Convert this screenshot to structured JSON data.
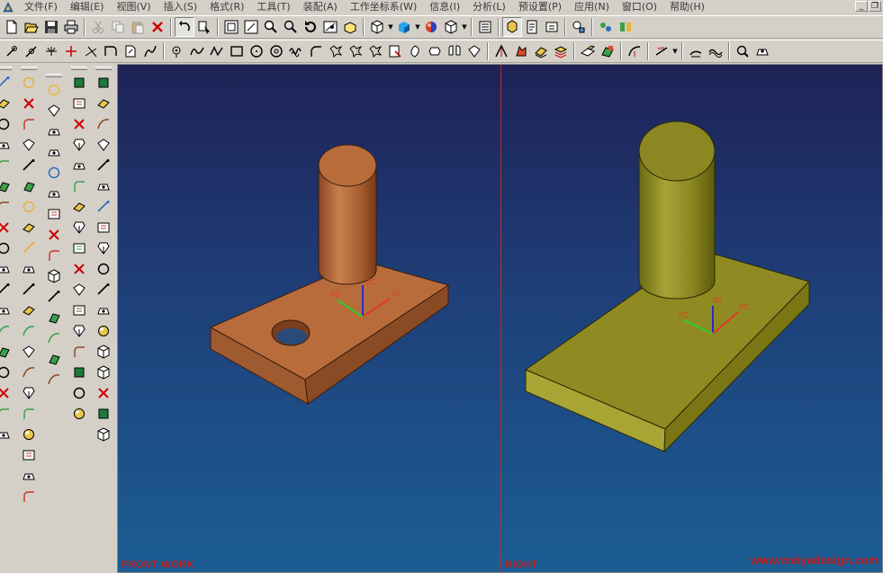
{
  "menu": {
    "items": [
      "文件(F)",
      "编辑(E)",
      "视图(V)",
      "插入(S)",
      "格式(R)",
      "工具(T)",
      "装配(A)",
      "工作坐标系(W)",
      "信息(I)",
      "分析(L)",
      "预设置(P)",
      "应用(N)",
      "窗口(O)",
      "帮助(H)"
    ]
  },
  "toolbar1": {
    "icons": [
      "new-file-icon",
      "open-file-icon",
      "save-icon",
      "print-icon",
      "cut-icon",
      "copy-icon",
      "paste-icon",
      "delete-icon",
      "undo-icon",
      "select-icon",
      "fit-icon",
      "zoom-window-icon",
      "zoom-icon",
      "pan-icon",
      "rotate-icon",
      "shade-mode-icon",
      "perspective-icon",
      "view-orient-icon",
      "render-cube-icon",
      "color-ball-icon",
      "layer-cube-icon",
      "layer-settings-icon",
      "modeling-app-icon",
      "drafting-app-icon",
      "info-icon",
      "measure-icon",
      "analysis-icon"
    ]
  },
  "toolbar2": {
    "icons": [
      "snap-end-icon",
      "snap-mid-icon",
      "snap-line-icon",
      "snap-point-icon",
      "snap-intersect-icon",
      "snap-arc-icon",
      "snap-face-icon",
      "snap-curve-icon",
      "point-icon",
      "spline-icon",
      "polyline-icon",
      "rectangle-icon",
      "circle-icon",
      "ellipse-icon",
      "helix-icon",
      "fillet-icon",
      "chamfer-icon",
      "offset-icon",
      "trim-icon",
      "extend-icon",
      "divide-icon",
      "join-icon",
      "bridge-icon",
      "project-icon",
      "mirror-icon",
      "section-icon",
      "hand-icon",
      "layer-stack-icon",
      "stack2-icon",
      "paint-icon",
      "color-icon",
      "arc-icon",
      "dimension-icon",
      "dropdown-icon",
      "sketch-icon",
      "curve-icon",
      "search-icon",
      "hole-icon"
    ]
  },
  "left_toolbars": {
    "strip1": [
      "line-tool-icon",
      "arc-tool-icon",
      "circle-tool-icon",
      "fillet-tool-icon",
      "chamfer-tool-icon",
      "rect-tool-icon",
      "polygon-tool-icon",
      "ellipse-tool-icon",
      "spline-tool-icon",
      "offset-tool-icon",
      "trim-tool-icon",
      "extend-tool-icon",
      "split-tool-icon",
      "join-tool-icon",
      "mirror-tool-icon",
      "project-tool-icon",
      "section-tool-icon",
      "bridge-tool-icon"
    ],
    "strip2": [
      "sketch-tool-icon",
      "extrude-tool-icon",
      "revolve-tool-icon",
      "sweep-tool-icon",
      "tube-tool-icon",
      "boss-tool-icon",
      "pocket-tool-icon",
      "pad-tool-icon",
      "slot-tool-icon",
      "groove-tool-icon",
      "hole-tool-icon",
      "rib-tool-icon",
      "shell-tool-icon",
      "draft-tool-icon",
      "blend-tool-icon",
      "chamfer3d-tool-icon",
      "pattern-tool-icon",
      "mirror3d-tool-icon",
      "delete-feature-icon",
      "replay-tool-icon",
      "edit-feature-icon"
    ],
    "strip3": [
      "datum-plane-icon",
      "datum-axis-icon",
      "csys-icon",
      "face-select-icon",
      "edge-select-icon",
      "body-select-icon",
      "feature-select-icon",
      "curve-select-icon",
      "point-select-icon",
      "filter-icon",
      "snap-tool-icon",
      "grid-tool-icon",
      "plane-tool-icon",
      "axis-tool-icon",
      "layer-tool-icon"
    ],
    "strip4": [
      "freeform-icon",
      "surface-icon",
      "ruled-icon",
      "through-curves-icon",
      "mesh-icon",
      "swept-icon",
      "section-surface-icon",
      "bridge-surface-icon",
      "offset-surface-icon",
      "trim-surface-icon",
      "sew-icon",
      "thicken-icon",
      "extract-icon",
      "block-icon",
      "cylinder-icon",
      "cone-icon",
      "sphere-icon"
    ],
    "strip5": [
      "iso-view-icon",
      "top-view-icon",
      "front-view-icon",
      "right-view-icon",
      "left-view-icon",
      "bottom-view-icon",
      "back-view-icon",
      "tfr-iso-icon",
      "tfr-tri-icon",
      "book-icon",
      "wireframe-icon",
      "hidden-line-icon",
      "shaded-icon",
      "studio-icon",
      "face-analysis-icon",
      "view-section-icon",
      "zoom-fit-icon",
      "render-icon"
    ]
  },
  "viewports": {
    "left": {
      "label": "FRONT WORK",
      "part_color": "#b8683a",
      "axes": {
        "x": "XC",
        "y": "YC",
        "z": "ZC"
      }
    },
    "right": {
      "label": "RIGHT",
      "part_color": "#8d8a24",
      "axes": {
        "x": "XC",
        "y": "YC",
        "z": "ZC"
      }
    }
  },
  "watermark": "www.meiyadesign.com",
  "colors": {
    "bg_top": "#1e2256",
    "bg_bottom": "#1b5e94",
    "label_red": "#c21a1a"
  }
}
